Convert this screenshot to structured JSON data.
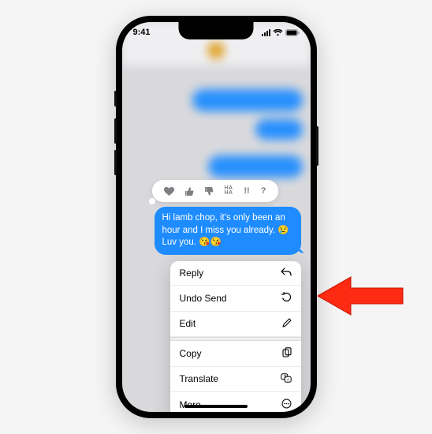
{
  "status": {
    "time": "9:41"
  },
  "tapbacks": [
    {
      "name": "heart",
      "glyph": "heart"
    },
    {
      "name": "thumbs-up",
      "glyph": "thumbs-up"
    },
    {
      "name": "thumbs-down",
      "glyph": "thumbs-down"
    },
    {
      "name": "haha",
      "glyph": "haha"
    },
    {
      "name": "exclaim",
      "glyph": "exclaim"
    },
    {
      "name": "question",
      "glyph": "question"
    }
  ],
  "message": {
    "text": "Hi lamb chop, it's only been an hour and I miss you already. 😢 Luv you. 😘😘"
  },
  "menu": {
    "reply": "Reply",
    "undo_send": "Undo Send",
    "edit": "Edit",
    "copy": "Copy",
    "translate": "Translate",
    "more": "More..."
  },
  "colors": {
    "imessage_blue": "#1e8cff",
    "arrow_red": "#ff2a12"
  }
}
